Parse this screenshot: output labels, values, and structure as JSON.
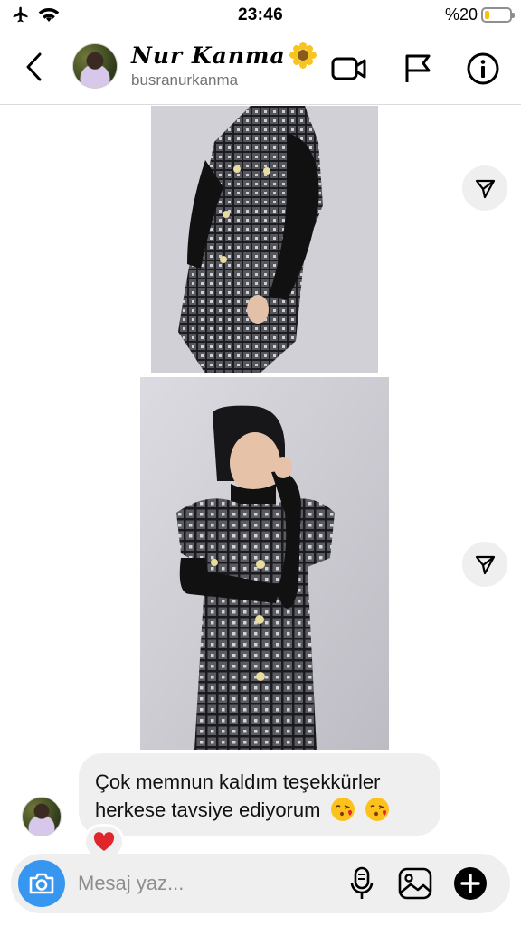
{
  "status_bar": {
    "time": "23:46",
    "battery_text": "%20",
    "battery_level": 0.2,
    "icons": [
      "airplane-icon",
      "wifi-icon",
      "battery-icon"
    ]
  },
  "header": {
    "contact_name": "Nur Kanma",
    "username": "busranurkanma",
    "icons": [
      "back-chevron-icon",
      "video-camera-icon",
      "flag-icon",
      "info-icon"
    ]
  },
  "messages": [
    {
      "type": "image",
      "description_icon": "photo"
    },
    {
      "type": "image",
      "description_icon": "photo"
    },
    {
      "type": "text",
      "line1": "Çok memnun kaldım teşekkürler",
      "line2": "herkese tavsiye ediyorum",
      "emojis": [
        "kissing-face-icon",
        "kissing-face-icon"
      ],
      "reaction": "heart-icon"
    }
  ],
  "composer": {
    "placeholder": "Mesaj yaz...",
    "icons": [
      "camera-icon",
      "microphone-icon",
      "gallery-icon",
      "plus-icon"
    ]
  },
  "colors": {
    "accent": "#3797f0",
    "bubble": "#efefef",
    "battery": "#f7c500",
    "reaction": "#e0262b"
  }
}
